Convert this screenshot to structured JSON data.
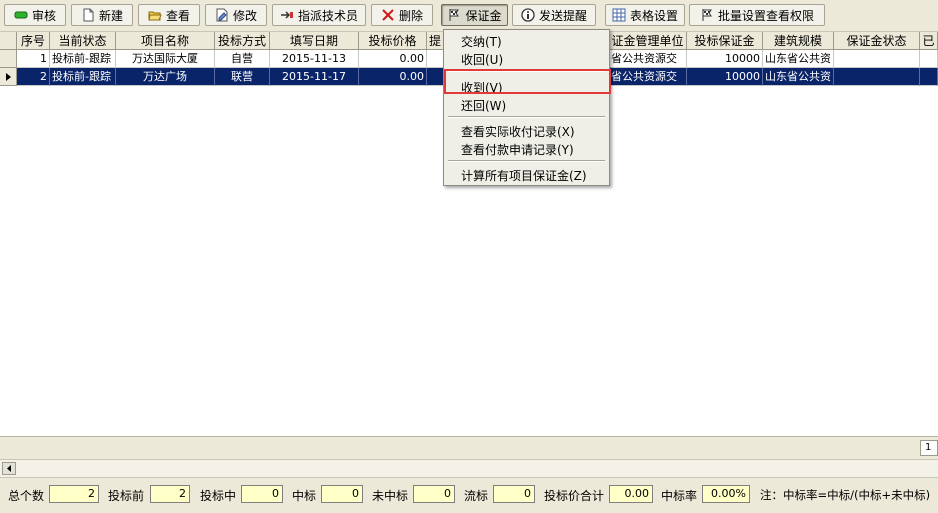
{
  "toolbar": {
    "audit": "审核",
    "new": "新建",
    "view": "查看",
    "edit": "修改",
    "assign_tech": "指派技术员",
    "delete": "删除",
    "deposit": "保证金",
    "send_reminder": "发送提醒",
    "table_settings": "表格设置",
    "batch_permissions": "批量设置查看权限"
  },
  "grid": {
    "columns": [
      "序号",
      "当前状态",
      "项目名称",
      "投标方式",
      "填写日期",
      "投标价格",
      "提",
      "",
      "证金管理单位",
      "投标保证金",
      "建筑规模",
      "保证金状态",
      "已"
    ],
    "rows": [
      {
        "no": "1",
        "status": "投标前-跟踪",
        "project": "万达国际大厦",
        "method": "自营",
        "date": "2015-11-13",
        "price": "0.00",
        "unit": "省公共资源交",
        "deposit": "10000",
        "scale": "山东省公共资",
        "deposit_status": ""
      },
      {
        "no": "2",
        "status": "投标前-跟踪",
        "project": "万达广场",
        "method": "联营",
        "date": "2015-11-17",
        "price": "0.00",
        "unit": "省公共资源交",
        "deposit": "10000",
        "scale": "山东省公共资",
        "deposit_status": ""
      }
    ],
    "footer_value": "1"
  },
  "menu": {
    "pay": "交纳(T)",
    "withdraw": "收回(U)",
    "received": "收到(V)",
    "return": "还回(W)",
    "view_actual": "查看实际收付记录(X)",
    "view_payment": "查看付款申请记录(Y)",
    "calc_all": "计算所有项目保证金(Z)"
  },
  "stats": {
    "total_label": "总个数",
    "total": "2",
    "pre_label": "投标前",
    "pre": "2",
    "mid_label": "投标中",
    "mid": "0",
    "win_label": "中标",
    "win": "0",
    "lose_label": "未中标",
    "lose": "0",
    "fail_label": "流标",
    "fail": "0",
    "sum_label": "投标价合计",
    "sum": "0.00",
    "rate_label": "中标率",
    "rate": "0.00%",
    "note": "注：中标率=中标/(中标+未中标)"
  },
  "colors": {
    "selection": "#0a246a",
    "highlight": "#e03a3a",
    "stat_box": "#ffffc8"
  }
}
